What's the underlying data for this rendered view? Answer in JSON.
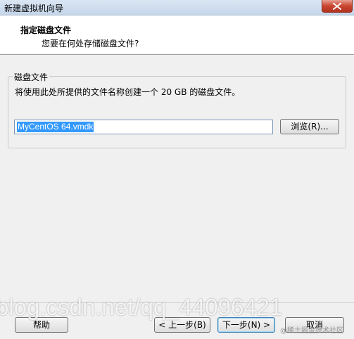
{
  "window": {
    "title": "新建虚拟机向导",
    "close_icon": "close-icon"
  },
  "header": {
    "title": "指定磁盘文件",
    "subtitle": "您要在何处存储磁盘文件?"
  },
  "disk_group": {
    "legend": "磁盘文件",
    "description": "将使用此处所提供的文件名称创建一个 20 GB 的磁盘文件。",
    "file_name_value": "MyCentOS 64.vmdk",
    "browse_label": "浏览(R)..."
  },
  "footer": {
    "help_label": "帮助",
    "back_label": "< 上一步(B)",
    "next_label": "下一步(N) >",
    "cancel_label": "取消"
  },
  "watermarks": {
    "url": "blog.csdn.net/qq_44096421",
    "corner": "@稀土掘金技术社区"
  },
  "colors": {
    "selection": "#3399ff",
    "close_button": "#c8452f",
    "default_button_border": "#3c7fb1"
  }
}
